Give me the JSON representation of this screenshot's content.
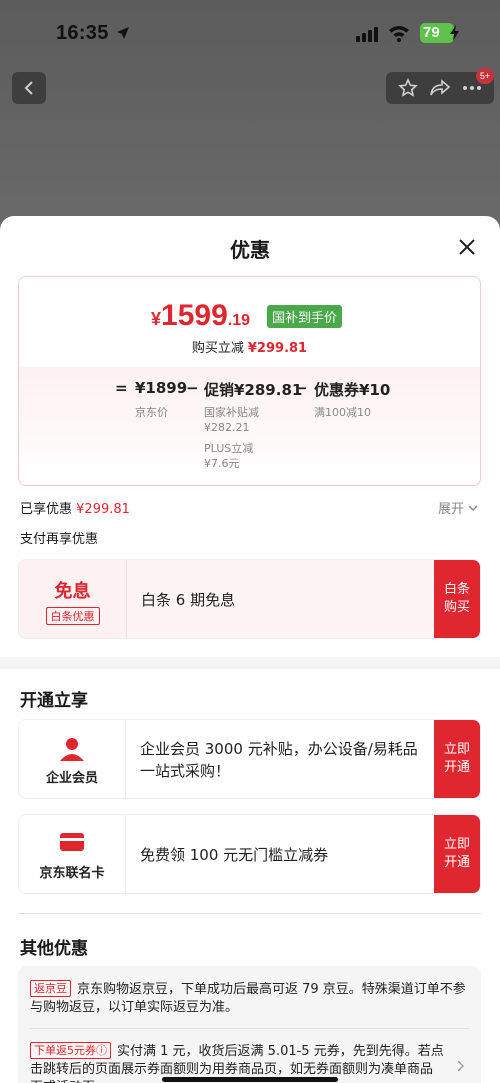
{
  "status_bar": {
    "time": "16:35",
    "battery": "79"
  },
  "nav": {
    "badge": "5+"
  },
  "sheet": {
    "title": "优惠",
    "price": {
      "currency": "¥",
      "integer": "1599",
      "decimal": ".19",
      "tag": "国补到手价",
      "save_label": "购买立减",
      "save_value": "¥299.81"
    },
    "formula": {
      "equals": "=",
      "jd_price": "¥1899",
      "minus1": "−",
      "promo": "促销¥289.81",
      "minus2": "−",
      "coupon": "优惠券¥10",
      "jd_price_label": "京东价",
      "promo_sub1": "国家补贴减",
      "promo_sub1_value": "¥282.21",
      "promo_sub2": "PLUS立减",
      "promo_sub2_value": "¥7.6元",
      "coupon_sub": "满100减10"
    },
    "enjoyed": {
      "label": "已享优惠",
      "value": "¥299.81",
      "expand": "展开"
    },
    "pay_more": "支付再享优惠",
    "mianxi": {
      "title": "免息",
      "tag": "白条优惠",
      "desc": "白条 6 期免息",
      "button": "白条\n购买"
    }
  },
  "open_section": {
    "heading": "开通立享",
    "cards": [
      {
        "label": "企业会员",
        "desc": "企业会员 3000 元补贴，办公设备/易耗品一站式采购！",
        "button": "立即\n开通"
      },
      {
        "label": "京东联名卡",
        "desc": "免费领 100 元无门槛立减券",
        "button": "立即\n开通"
      }
    ]
  },
  "other_section": {
    "heading": "其他优惠",
    "rows": [
      {
        "tag": "返京豆",
        "text": "京东购物返京豆，下单成功后最高可返 79 京豆。特殊渠道订单不参与购物返豆，以订单实际返豆为准。"
      },
      {
        "tag": "下单返5元券ⓘ",
        "text": "实付满 1 元，收货后返满 5.01-5 元券，先到先得。若点击跳转后的页面展示券面额则为用券商品页，如无券面额则为凑单商品页或活动页。"
      }
    ]
  },
  "colors": {
    "accent": "#e0262f",
    "green_tag": "#4aa94a",
    "battery": "#5fc24a"
  }
}
